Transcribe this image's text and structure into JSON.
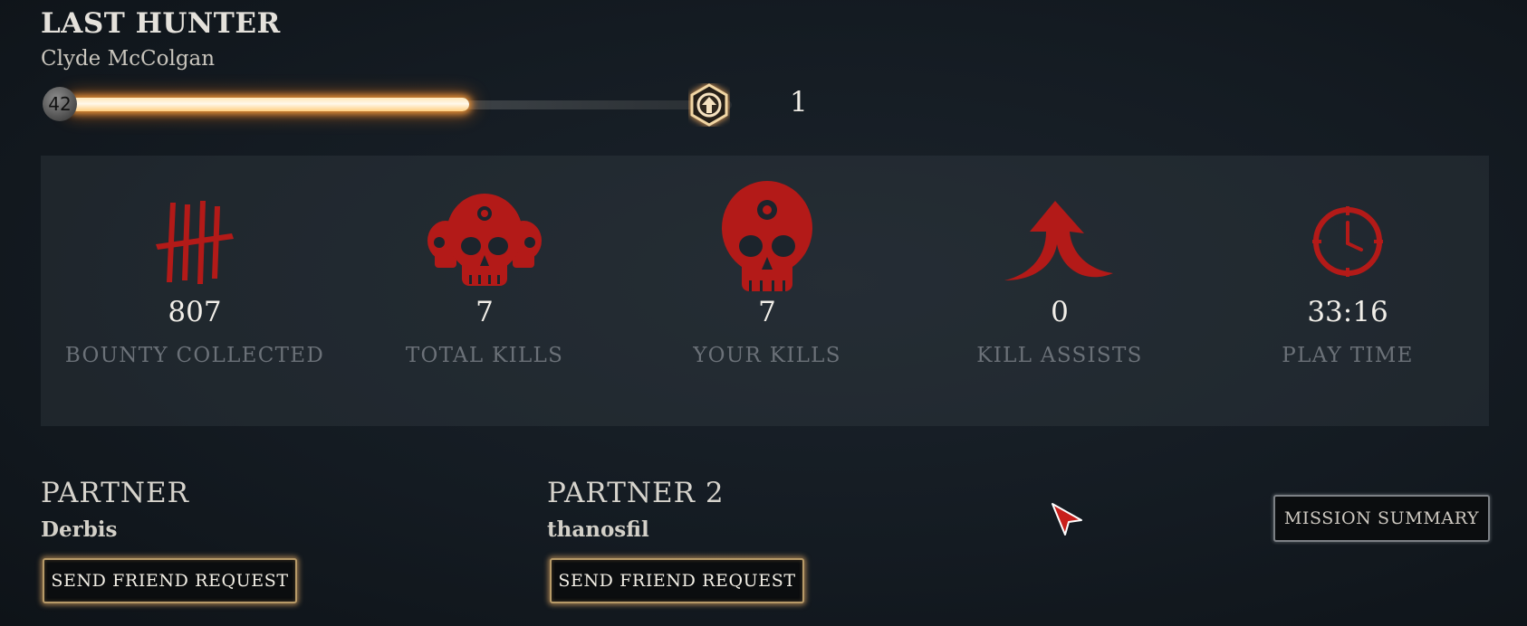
{
  "header": {
    "rank_title": "LAST HUNTER",
    "hunter_name": "Clyde McColgan",
    "level": "42",
    "xp_progress": 0.6,
    "prestige_count": "1"
  },
  "stats": [
    {
      "icon": "tally-marks-icon",
      "value": "807",
      "label": "BOUNTY COLLECTED"
    },
    {
      "icon": "skull-group-icon",
      "value": "7",
      "label": "TOTAL KILLS"
    },
    {
      "icon": "skull-icon",
      "value": "7",
      "label": "YOUR KILLS"
    },
    {
      "icon": "assist-arrow-icon",
      "value": "0",
      "label": "KILL ASSISTS"
    },
    {
      "icon": "clock-icon",
      "value": "33:16",
      "label": "PLAY TIME"
    }
  ],
  "partners": [
    {
      "heading": "PARTNER",
      "name": "Derbis",
      "button": "SEND FRIEND REQUEST"
    },
    {
      "heading": "PARTNER 2",
      "name": "thanosfil",
      "button": "SEND FRIEND REQUEST"
    }
  ],
  "mission_summary_label": "MISSION SUMMARY",
  "colors": {
    "accent_red": "#b31a18",
    "glow_orange": "#ff9c3a",
    "button_gold": "#b79a68"
  }
}
